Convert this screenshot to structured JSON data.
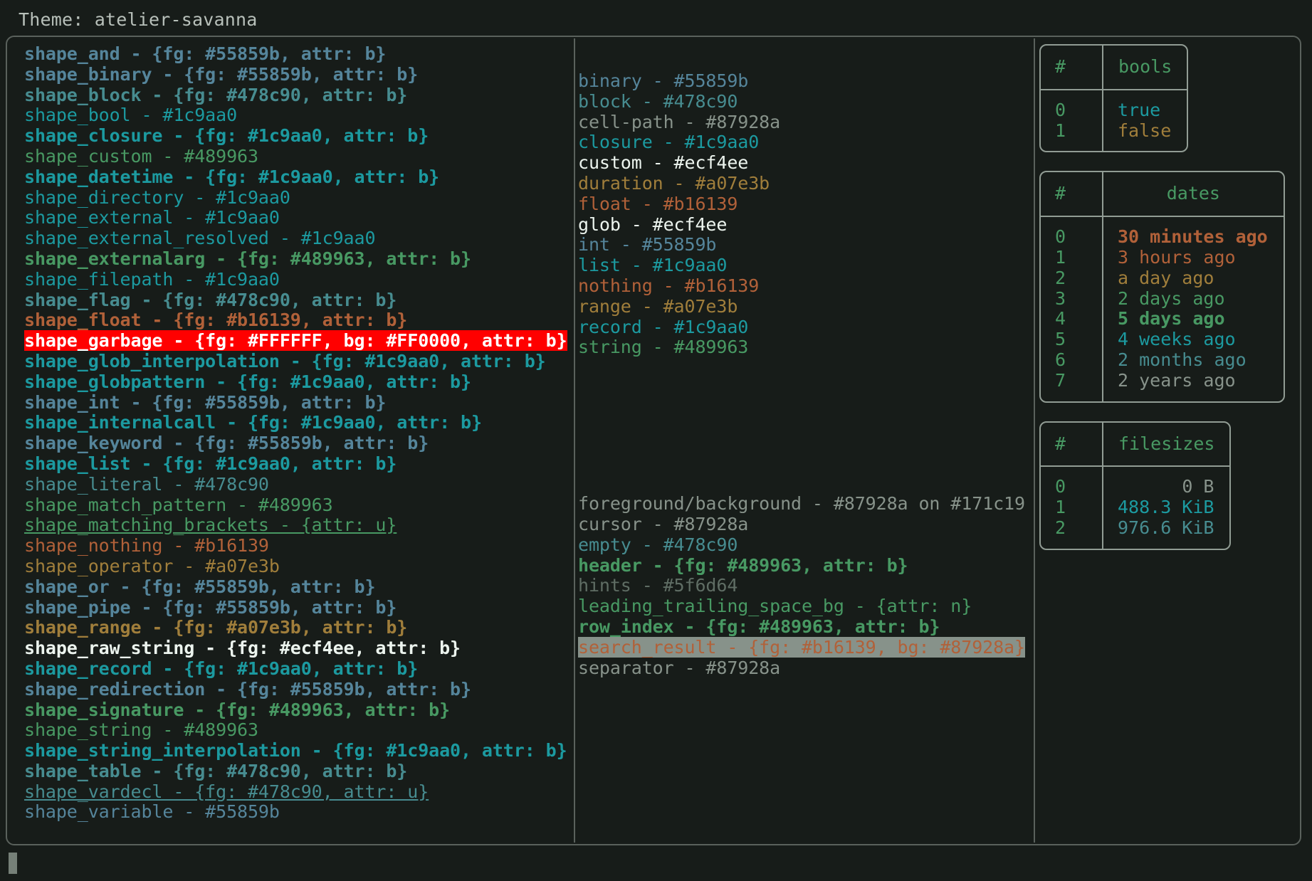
{
  "header": {
    "theme_label": "Theme: atelier-savanna"
  },
  "palette": {
    "background": "#171c19",
    "foreground": "#87928a",
    "blue": "#55859b",
    "teal": "#478c90",
    "cyan": "#1c9aa0",
    "green": "#489963",
    "orange": "#b16139",
    "gold": "#a07e3b",
    "white": "#ecf4ee",
    "grey": "#5f6d64",
    "border": "#919c94",
    "garbage_fg": "#FFFFFF",
    "garbage_bg": "#FF0000",
    "search_bg": "#87928a"
  },
  "shapes": [
    {
      "text": "shape_and - {fg: #55859b, attr: b}",
      "color": "#55859b",
      "bold": true,
      "underline": false
    },
    {
      "text": "shape_binary - {fg: #55859b, attr: b}",
      "color": "#55859b",
      "bold": true,
      "underline": false
    },
    {
      "text": "shape_block - {fg: #478c90, attr: b}",
      "color": "#478c90",
      "bold": true,
      "underline": false
    },
    {
      "text": "shape_bool - #1c9aa0",
      "color": "#1c9aa0",
      "bold": false,
      "underline": false
    },
    {
      "text": "shape_closure - {fg: #1c9aa0, attr: b}",
      "color": "#1c9aa0",
      "bold": true,
      "underline": false
    },
    {
      "text": "shape_custom - #489963",
      "color": "#489963",
      "bold": false,
      "underline": false
    },
    {
      "text": "shape_datetime - {fg: #1c9aa0, attr: b}",
      "color": "#1c9aa0",
      "bold": true,
      "underline": false
    },
    {
      "text": "shape_directory - #1c9aa0",
      "color": "#1c9aa0",
      "bold": false,
      "underline": false
    },
    {
      "text": "shape_external - #1c9aa0",
      "color": "#1c9aa0",
      "bold": false,
      "underline": false
    },
    {
      "text": "shape_external_resolved - #1c9aa0",
      "color": "#1c9aa0",
      "bold": false,
      "underline": false
    },
    {
      "text": "shape_externalarg - {fg: #489963, attr: b}",
      "color": "#489963",
      "bold": true,
      "underline": false
    },
    {
      "text": "shape_filepath - #1c9aa0",
      "color": "#1c9aa0",
      "bold": false,
      "underline": false
    },
    {
      "text": "shape_flag - {fg: #478c90, attr: b}",
      "color": "#478c90",
      "bold": true,
      "underline": false
    },
    {
      "text": "shape_float - {fg: #b16139, attr: b}",
      "color": "#b16139",
      "bold": true,
      "underline": false
    },
    {
      "text": "shape_garbage - {fg: #FFFFFF, bg: #FF0000, attr: b}",
      "color": "#FFFFFF",
      "background": "#FF0000",
      "bold": true,
      "underline": false
    },
    {
      "text": "shape_glob_interpolation - {fg: #1c9aa0, attr: b}",
      "color": "#1c9aa0",
      "bold": true,
      "underline": false
    },
    {
      "text": "shape_globpattern - {fg: #1c9aa0, attr: b}",
      "color": "#1c9aa0",
      "bold": true,
      "underline": false
    },
    {
      "text": "shape_int - {fg: #55859b, attr: b}",
      "color": "#55859b",
      "bold": true,
      "underline": false
    },
    {
      "text": "shape_internalcall - {fg: #1c9aa0, attr: b}",
      "color": "#1c9aa0",
      "bold": true,
      "underline": false
    },
    {
      "text": "shape_keyword - {fg: #55859b, attr: b}",
      "color": "#55859b",
      "bold": true,
      "underline": false
    },
    {
      "text": "shape_list - {fg: #1c9aa0, attr: b}",
      "color": "#1c9aa0",
      "bold": true,
      "underline": false
    },
    {
      "text": "shape_literal - #478c90",
      "color": "#478c90",
      "bold": false,
      "underline": false
    },
    {
      "text": "shape_match_pattern - #489963",
      "color": "#489963",
      "bold": false,
      "underline": false
    },
    {
      "text": "shape_matching_brackets - {attr: u}",
      "color": "#489963",
      "bold": false,
      "underline": true
    },
    {
      "text": "shape_nothing - #b16139",
      "color": "#b16139",
      "bold": false,
      "underline": false
    },
    {
      "text": "shape_operator - #a07e3b",
      "color": "#a07e3b",
      "bold": false,
      "underline": false
    },
    {
      "text": "shape_or - {fg: #55859b, attr: b}",
      "color": "#55859b",
      "bold": true,
      "underline": false
    },
    {
      "text": "shape_pipe - {fg: #55859b, attr: b}",
      "color": "#55859b",
      "bold": true,
      "underline": false
    },
    {
      "text": "shape_range - {fg: #a07e3b, attr: b}",
      "color": "#a07e3b",
      "bold": true,
      "underline": false
    },
    {
      "text": "shape_raw_string - {fg: #ecf4ee, attr: b}",
      "color": "#ecf4ee",
      "bold": true,
      "underline": false
    },
    {
      "text": "shape_record - {fg: #1c9aa0, attr: b}",
      "color": "#1c9aa0",
      "bold": true,
      "underline": false
    },
    {
      "text": "shape_redirection - {fg: #55859b, attr: b}",
      "color": "#55859b",
      "bold": true,
      "underline": false
    },
    {
      "text": "shape_signature - {fg: #489963, attr: b}",
      "color": "#489963",
      "bold": true,
      "underline": false
    },
    {
      "text": "shape_string - #489963",
      "color": "#489963",
      "bold": false,
      "underline": false
    },
    {
      "text": "shape_string_interpolation - {fg: #1c9aa0, attr: b}",
      "color": "#1c9aa0",
      "bold": true,
      "underline": false
    },
    {
      "text": "shape_table - {fg: #478c90, attr: b}",
      "color": "#478c90",
      "bold": true,
      "underline": false
    },
    {
      "text": "shape_vardecl - {fg: #478c90, attr: u}",
      "color": "#478c90",
      "bold": false,
      "underline": true
    },
    {
      "text": "shape_variable - #55859b",
      "color": "#55859b",
      "bold": false,
      "underline": false
    }
  ],
  "types": [
    {
      "text": "binary - #55859b",
      "color": "#55859b",
      "bold": false,
      "underline": false
    },
    {
      "text": "block - #478c90",
      "color": "#478c90",
      "bold": false,
      "underline": false
    },
    {
      "text": "cell-path - #87928a",
      "color": "#87928a",
      "bold": false,
      "underline": false
    },
    {
      "text": "closure - #1c9aa0",
      "color": "#1c9aa0",
      "bold": false,
      "underline": false
    },
    {
      "text": "custom - #ecf4ee",
      "color": "#ecf4ee",
      "bold": false,
      "underline": false
    },
    {
      "text": "duration - #a07e3b",
      "color": "#a07e3b",
      "bold": false,
      "underline": false
    },
    {
      "text": "float - #b16139",
      "color": "#b16139",
      "bold": false,
      "underline": false
    },
    {
      "text": "glob - #ecf4ee",
      "color": "#ecf4ee",
      "bold": false,
      "underline": false
    },
    {
      "text": "int - #55859b",
      "color": "#55859b",
      "bold": false,
      "underline": false
    },
    {
      "text": "list - #1c9aa0",
      "color": "#1c9aa0",
      "bold": false,
      "underline": false
    },
    {
      "text": "nothing - #b16139",
      "color": "#b16139",
      "bold": false,
      "underline": false
    },
    {
      "text": "range - #a07e3b",
      "color": "#a07e3b",
      "bold": false,
      "underline": false
    },
    {
      "text": "record - #1c9aa0",
      "color": "#1c9aa0",
      "bold": false,
      "underline": false
    },
    {
      "text": "string - #489963",
      "color": "#489963",
      "bold": false,
      "underline": false
    }
  ],
  "ui_elements": [
    {
      "text": "foreground/background - #87928a on #171c19",
      "color": "#87928a",
      "bold": false,
      "underline": false
    },
    {
      "text": "cursor - #87928a",
      "color": "#87928a",
      "bold": false,
      "underline": false
    },
    {
      "text": "empty - #478c90",
      "color": "#478c90",
      "bold": false,
      "underline": false
    },
    {
      "text": "header - {fg: #489963, attr: b}",
      "color": "#489963",
      "bold": true,
      "underline": false
    },
    {
      "text": "hints - #5f6d64",
      "color": "#5f6d64",
      "bold": false,
      "underline": false
    },
    {
      "text": "leading_trailing_space_bg - {attr: n}",
      "color": "#489963",
      "bold": false,
      "underline": false
    },
    {
      "text": "row_index - {fg: #489963, attr: b}",
      "color": "#489963",
      "bold": true,
      "underline": false
    },
    {
      "text": "search_result - {fg: #b16139, bg: #87928a}",
      "color": "#b16139",
      "background": "#87928a",
      "bold": false,
      "underline": false
    },
    {
      "text": "separator - #87928a",
      "color": "#87928a",
      "bold": false,
      "underline": false
    }
  ],
  "tables": [
    {
      "name": "bools",
      "headers": [
        "#",
        "bools"
      ],
      "align": "left",
      "rows": [
        {
          "index": "0",
          "value": "true",
          "color": "#1c9aa0",
          "bold": false
        },
        {
          "index": "1",
          "value": "false",
          "color": "#a07e3b",
          "bold": false
        }
      ]
    },
    {
      "name": "dates",
      "headers": [
        "#",
        "dates"
      ],
      "align": "left",
      "rows": [
        {
          "index": "0",
          "value": "30 minutes ago",
          "color": "#b16139",
          "bold": true
        },
        {
          "index": "1",
          "value": "3 hours ago",
          "color": "#b16139",
          "bold": false
        },
        {
          "index": "2",
          "value": "a day ago",
          "color": "#a07e3b",
          "bold": false
        },
        {
          "index": "3",
          "value": "2 days ago",
          "color": "#489963",
          "bold": false
        },
        {
          "index": "4",
          "value": "5 days ago",
          "color": "#489963",
          "bold": true
        },
        {
          "index": "5",
          "value": "4 weeks ago",
          "color": "#1c9aa0",
          "bold": false
        },
        {
          "index": "6",
          "value": "2 months ago",
          "color": "#478c90",
          "bold": false
        },
        {
          "index": "7",
          "value": "2 years ago",
          "color": "#87928a",
          "bold": false
        }
      ]
    },
    {
      "name": "filesizes",
      "headers": [
        "#",
        "filesizes"
      ],
      "align": "right",
      "rows": [
        {
          "index": "0",
          "value": "0 B",
          "color": "#87928a",
          "bold": false
        },
        {
          "index": "1",
          "value": "488.3 KiB",
          "color": "#1c9aa0",
          "bold": false
        },
        {
          "index": "2",
          "value": "976.6 KiB",
          "color": "#478c90",
          "bold": false
        }
      ]
    }
  ]
}
